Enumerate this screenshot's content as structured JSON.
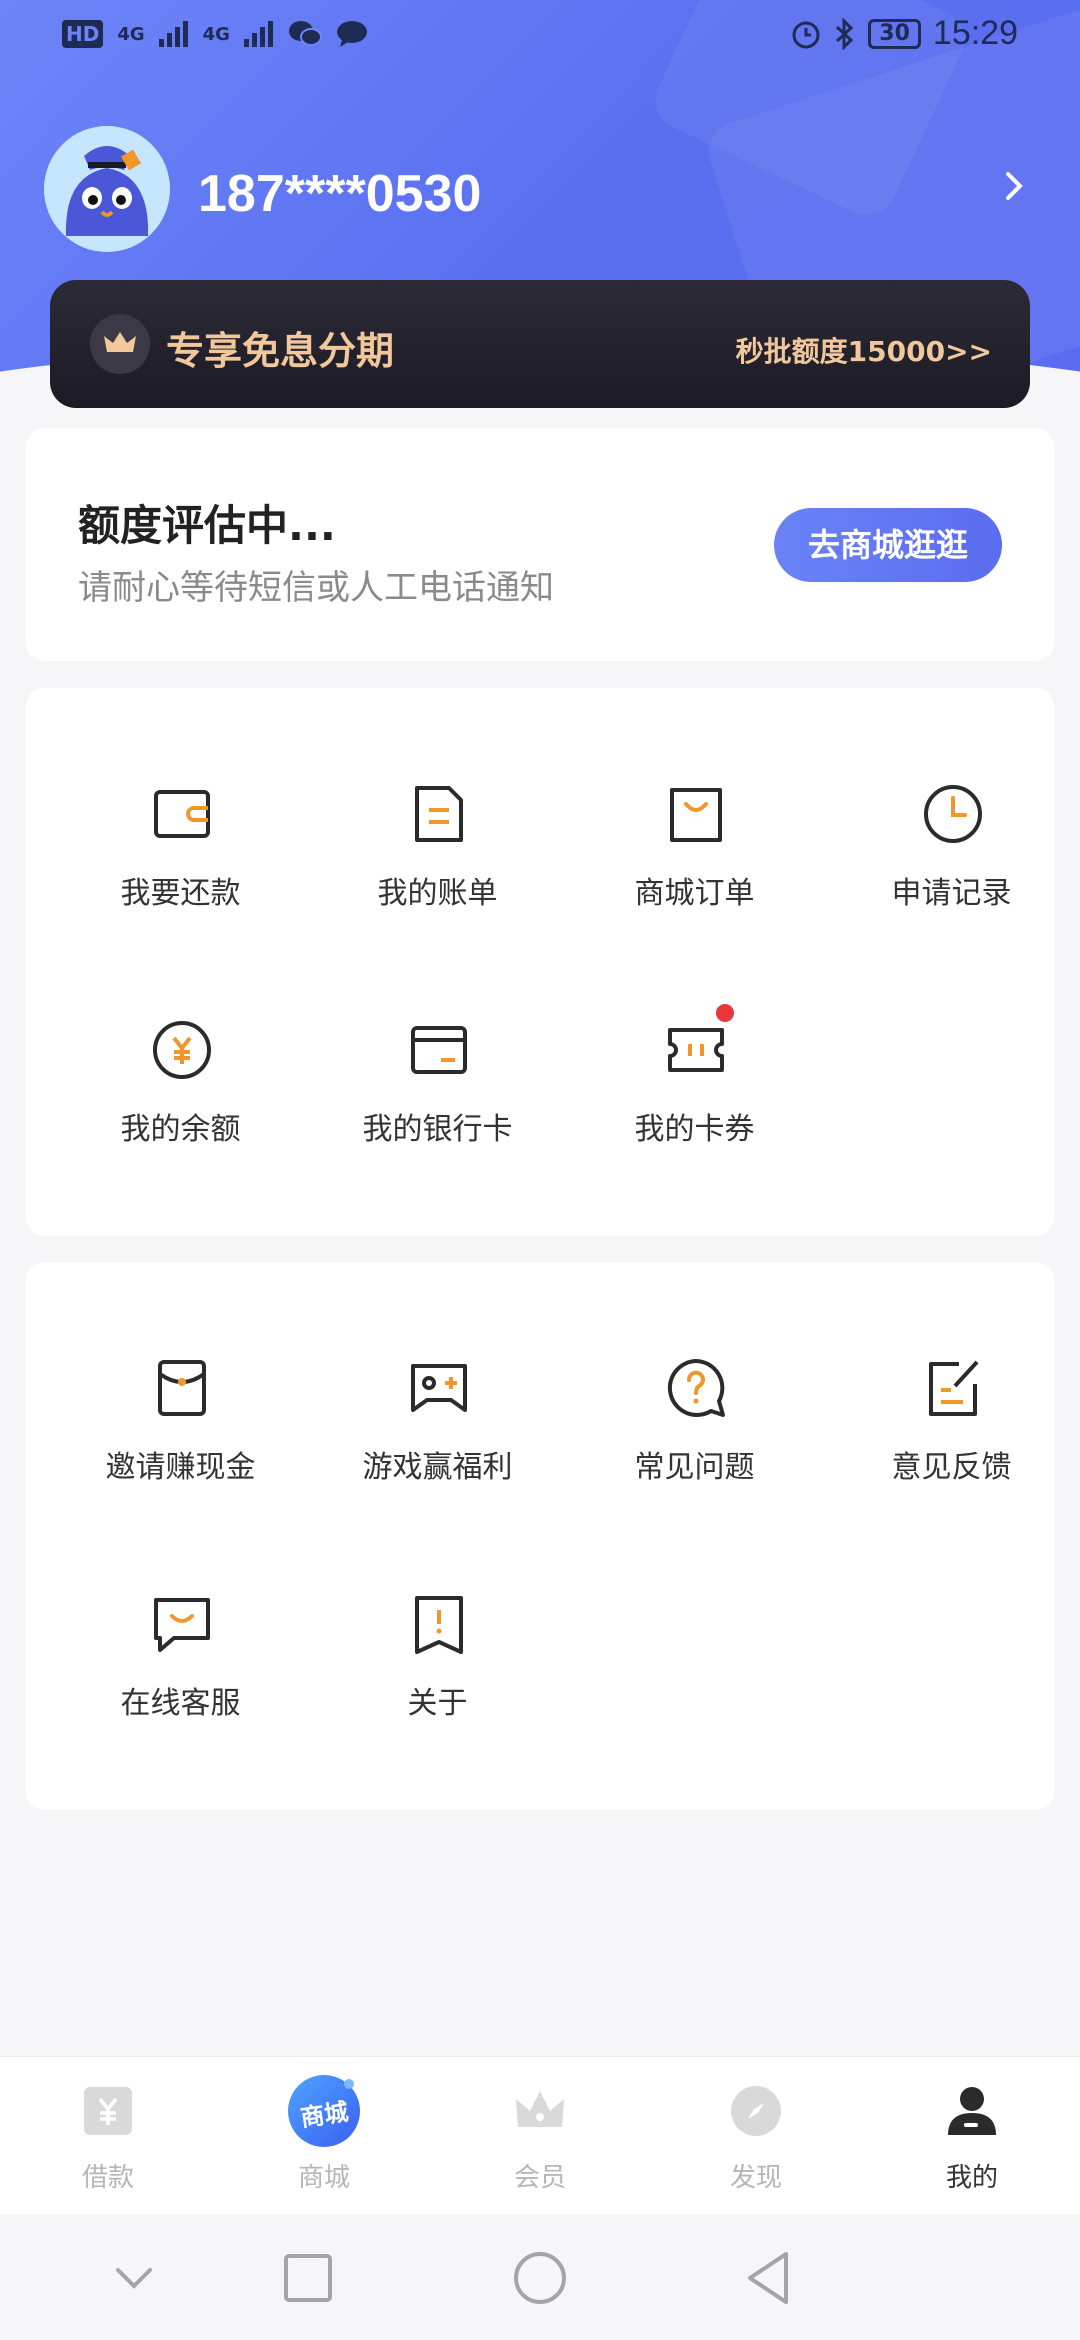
{
  "status_bar": {
    "left_hd": "HD",
    "network1": "4G",
    "network2": "4G",
    "battery": "30",
    "time": "15:29"
  },
  "profile": {
    "phone": "187****0530"
  },
  "vip": {
    "title": "专享免息分期",
    "right_text": "秒批额度15000>>"
  },
  "credit_card": {
    "title": "额度评估中...",
    "subtitle": "请耐心等待短信或人工电话通知",
    "button": "去商城逛逛"
  },
  "menu1": {
    "items": [
      {
        "label": "我要还款",
        "icon": "wallet-icon"
      },
      {
        "label": "我的账单",
        "icon": "bill-icon"
      },
      {
        "label": "商城订单",
        "icon": "shopping-bag-icon"
      },
      {
        "label": "申请记录",
        "icon": "clock-icon"
      },
      {
        "label": "我的余额",
        "icon": "yen-coin-icon"
      },
      {
        "label": "我的银行卡",
        "icon": "bank-card-icon"
      },
      {
        "label": "我的卡券",
        "icon": "coupon-icon"
      }
    ]
  },
  "menu2": {
    "items": [
      {
        "label": "邀请赚现金",
        "icon": "red-envelope-icon"
      },
      {
        "label": "游戏赢福利",
        "icon": "game-icon"
      },
      {
        "label": "常见问题",
        "icon": "question-icon"
      },
      {
        "label": "意见反馈",
        "icon": "feedback-icon"
      },
      {
        "label": "在线客服",
        "icon": "chat-icon"
      },
      {
        "label": "关于",
        "icon": "about-icon"
      }
    ]
  },
  "bottom_nav": {
    "tabs": [
      {
        "label": "借款",
        "icon": "yen-tab-icon"
      },
      {
        "label": "商城",
        "icon": "mall-tab-icon",
        "badge_text": "商城"
      },
      {
        "label": "会员",
        "icon": "crown-tab-icon"
      },
      {
        "label": "发现",
        "icon": "compass-tab-icon"
      },
      {
        "label": "我的",
        "icon": "user-tab-icon",
        "active": true
      }
    ]
  },
  "colors": {
    "header": "#6d84f8",
    "accent_orange": "#f0962b",
    "vip_gold": "#f2c79b",
    "button_blue": "#5b6cf0"
  }
}
